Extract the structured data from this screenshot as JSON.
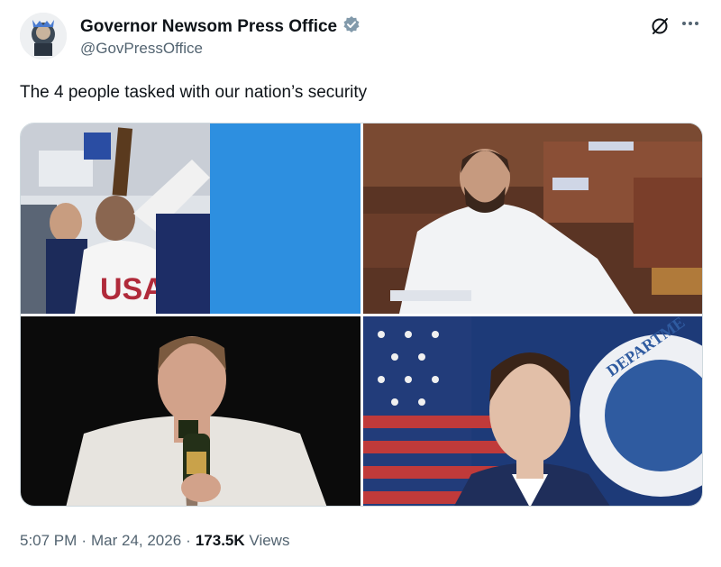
{
  "author": {
    "name": "Governor Newsom Press Office",
    "handle": "@GovPressOffice",
    "verified": true,
    "verified_color": "#829aab"
  },
  "tweet": {
    "text": "The 4 people tasked with our nation’s security"
  },
  "media": {
    "images": [
      {
        "description": "man drinking from bottle wearing USA jersey",
        "jersey_text": "USA"
      },
      {
        "description": "bearded man in white shirt seated among chamber chairs"
      },
      {
        "description": "man in wet white shirt holding champagne bottle"
      },
      {
        "description": "man in suit in front of flag and department seal",
        "seal_text": "DEPARTME"
      }
    ]
  },
  "footer": {
    "time": "5:07 PM",
    "date": "Mar 24, 2026",
    "views_count": "173.5K",
    "views_label": "Views",
    "separator": "·"
  },
  "icons": {
    "grok": "grok-icon",
    "more": "more-options-icon",
    "verified": "verified-badge-icon"
  },
  "colors": {
    "text_primary": "#0f1419",
    "text_secondary": "#536471"
  }
}
